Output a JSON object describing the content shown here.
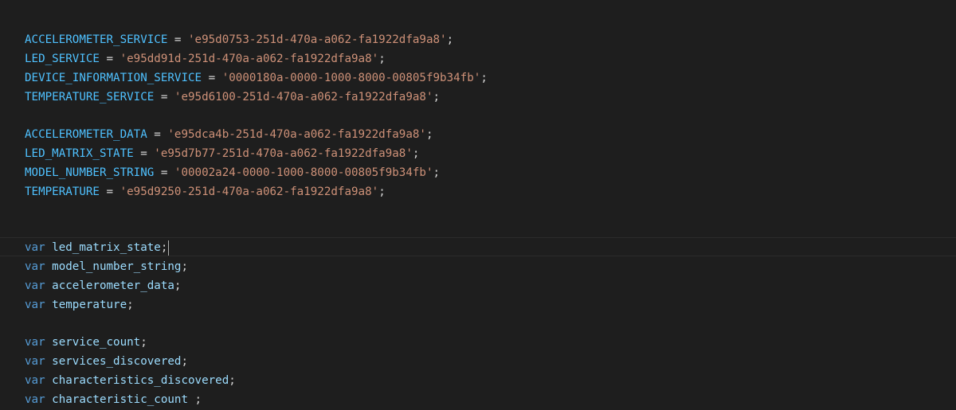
{
  "editor": {
    "constants": [
      {
        "name": "ACCELEROMETER_SERVICE",
        "value": "'e95d0753-251d-470a-a062-fa1922dfa9a8'"
      },
      {
        "name": "LED_SERVICE",
        "value": "'e95dd91d-251d-470a-a062-fa1922dfa9a8'"
      },
      {
        "name": "DEVICE_INFORMATION_SERVICE",
        "value": "'0000180a-0000-1000-8000-00805f9b34fb'"
      },
      {
        "name": "TEMPERATURE_SERVICE",
        "value": "'e95d6100-251d-470a-a062-fa1922dfa9a8'"
      },
      {
        "name": "ACCELEROMETER_DATA",
        "value": "'e95dca4b-251d-470a-a062-fa1922dfa9a8'"
      },
      {
        "name": "LED_MATRIX_STATE",
        "value": "'e95d7b77-251d-470a-a062-fa1922dfa9a8'"
      },
      {
        "name": "MODEL_NUMBER_STRING",
        "value": "'00002a24-0000-1000-8000-00805f9b34fb'"
      },
      {
        "name": "TEMPERATURE",
        "value": "'e95d9250-251d-470a-a062-fa1922dfa9a8'"
      }
    ],
    "vars": [
      {
        "keyword": "var",
        "name": "led_matrix_state",
        "end": ";"
      },
      {
        "keyword": "var",
        "name": "model_number_string",
        "end": ";"
      },
      {
        "keyword": "var",
        "name": "accelerometer_data",
        "end": ";"
      },
      {
        "keyword": "var",
        "name": "temperature",
        "end": ";"
      },
      {
        "keyword": "var",
        "name": "service_count",
        "end": ";"
      },
      {
        "keyword": "var",
        "name": "services_discovered",
        "end": ";"
      },
      {
        "keyword": "var",
        "name": "characteristics_discovered",
        "end": ";"
      },
      {
        "keyword": "var",
        "name": "characteristic_count",
        "end": " ;"
      }
    ],
    "operators": {
      "assign": " = ",
      "semicolon": ";"
    },
    "colors": {
      "background": "#1e1e1e",
      "constant": "#4fc1ff",
      "string": "#ce9178",
      "keyword": "#569cd6",
      "identifier": "#d4d4d4"
    }
  }
}
